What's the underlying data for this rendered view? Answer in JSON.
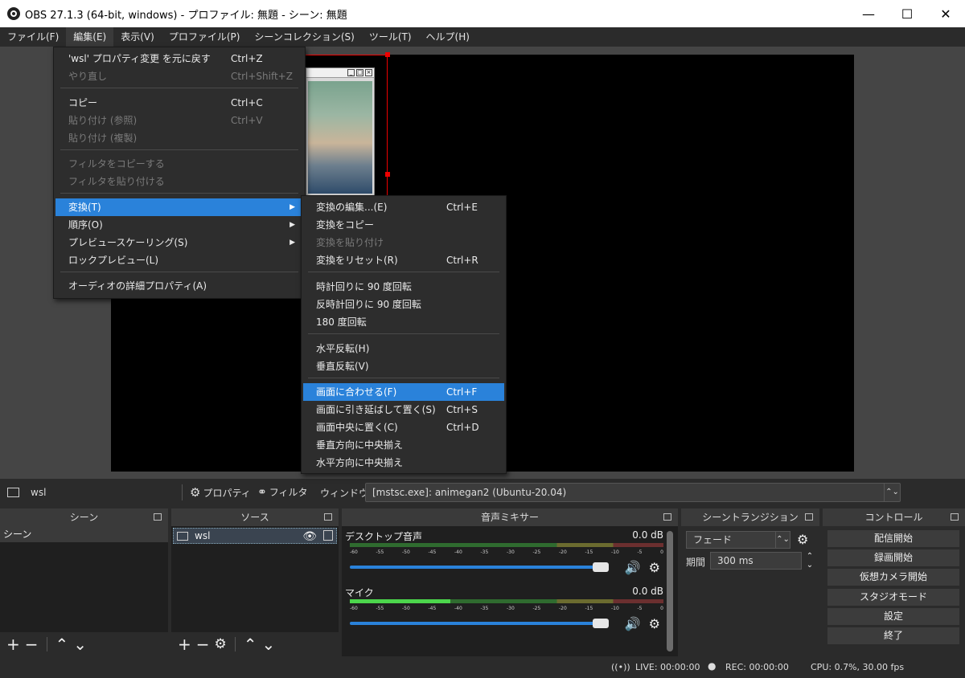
{
  "window": {
    "title": "OBS 27.1.3 (64-bit, windows) - プロファイル: 無題 - シーン: 無題",
    "minimize": "—",
    "maximize": "☐",
    "close": "✕"
  },
  "menubar": {
    "items": [
      "ファイル(F)",
      "編集(E)",
      "表示(V)",
      "プロファイル(P)",
      "シーンコレクション(S)",
      "ツール(T)",
      "ヘルプ(H)"
    ]
  },
  "edit_menu": {
    "items": [
      {
        "label": "'wsl' プロパティ変更 を元に戻す",
        "shortcut": "Ctrl+Z",
        "disabled": false
      },
      {
        "label": "やり直し",
        "shortcut": "Ctrl+Shift+Z",
        "disabled": true
      },
      {
        "label": "コピー",
        "shortcut": "Ctrl+C",
        "disabled": false
      },
      {
        "label": "貼り付け (参照)",
        "shortcut": "Ctrl+V",
        "disabled": true
      },
      {
        "label": "貼り付け (複製)",
        "shortcut": "",
        "disabled": true
      },
      {
        "label": "フィルタをコピーする",
        "shortcut": "",
        "disabled": true
      },
      {
        "label": "フィルタを貼り付ける",
        "shortcut": "",
        "disabled": true
      },
      {
        "label": "変換(T)",
        "shortcut": "",
        "disabled": false
      },
      {
        "label": "順序(O)",
        "shortcut": "",
        "disabled": false
      },
      {
        "label": "プレビュースケーリング(S)",
        "shortcut": "",
        "disabled": false
      },
      {
        "label": "ロックプレビュー(L)",
        "shortcut": "",
        "disabled": false
      },
      {
        "label": "オーディオの詳細プロパティ(A)",
        "shortcut": "",
        "disabled": false
      }
    ]
  },
  "transform_menu": {
    "items": [
      {
        "label": "変換の編集...(E)",
        "shortcut": "Ctrl+E",
        "disabled": false
      },
      {
        "label": "変換をコピー",
        "shortcut": "",
        "disabled": false
      },
      {
        "label": "変換を貼り付け",
        "shortcut": "",
        "disabled": true
      },
      {
        "label": "変換をリセット(R)",
        "shortcut": "Ctrl+R",
        "disabled": false
      },
      {
        "label": "時計回りに 90 度回転",
        "shortcut": "",
        "disabled": false
      },
      {
        "label": "反時計回りに 90 度回転",
        "shortcut": "",
        "disabled": false
      },
      {
        "label": "180 度回転",
        "shortcut": "",
        "disabled": false
      },
      {
        "label": "水平反転(H)",
        "shortcut": "",
        "disabled": false
      },
      {
        "label": "垂直反転(V)",
        "shortcut": "",
        "disabled": false
      },
      {
        "label": "画面に合わせる(F)",
        "shortcut": "Ctrl+F",
        "disabled": false
      },
      {
        "label": "画面に引き延ばして置く(S)",
        "shortcut": "Ctrl+S",
        "disabled": false
      },
      {
        "label": "画面中央に置く(C)",
        "shortcut": "Ctrl+D",
        "disabled": false
      },
      {
        "label": "垂直方向に中央揃え",
        "shortcut": "",
        "disabled": false
      },
      {
        "label": "水平方向に中央揃え",
        "shortcut": "",
        "disabled": false
      }
    ]
  },
  "source_toolbar": {
    "selected_source": "wsl",
    "properties_label": "プロパティ",
    "filters_label": "フィルタ",
    "window_label": "ウィンドウ",
    "window_value": "[mstsc.exe]: animegan2 (Ubuntu-20.04)"
  },
  "docks": {
    "scenes": {
      "title": "シーン",
      "items": [
        "シーン"
      ]
    },
    "sources": {
      "title": "ソース",
      "items": [
        "wsl"
      ]
    },
    "mixer": {
      "title": "音声ミキサー",
      "ticks": [
        "-60",
        "-55",
        "-50",
        "-45",
        "-40",
        "-35",
        "-30",
        "-25",
        "-20",
        "-15",
        "-10",
        "-5",
        "0"
      ],
      "channels": [
        {
          "name": "デスクトップ音声",
          "db": "0.0 dB",
          "level": 0.0,
          "volume": 1.0
        },
        {
          "name": "マイク",
          "db": "0.0 dB",
          "level": 0.32,
          "volume": 1.0
        }
      ]
    },
    "transitions": {
      "title": "シーントランジション",
      "type": "フェード",
      "duration_label": "期間",
      "duration": "300 ms"
    },
    "controls": {
      "title": "コントロール",
      "buttons": [
        "配信開始",
        "録画開始",
        "仮想カメラ開始",
        "スタジオモード",
        "設定",
        "終了"
      ]
    }
  },
  "status": {
    "live": "LIVE: 00:00:00",
    "rec": "REC: 00:00:00",
    "cpu": "CPU: 0.7%, 30.00 fps"
  }
}
